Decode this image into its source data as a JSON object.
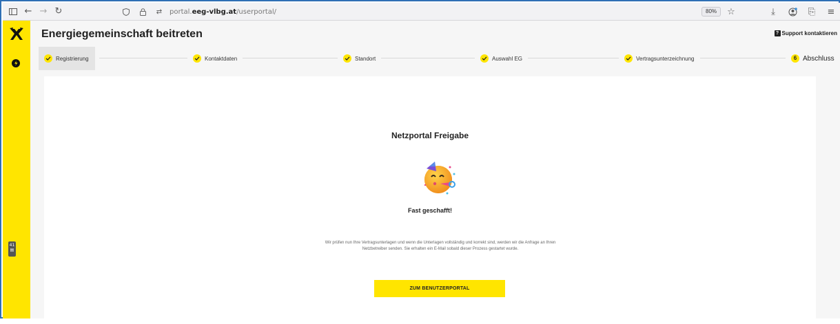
{
  "browser": {
    "url_prefix": "portal.",
    "url_domain": "eeg-vlbg.at",
    "url_path": "/userportal/",
    "zoom": "80%",
    "back_icon": "arrow-left-icon",
    "forward_icon": "arrow-right-icon",
    "reload_icon": "reload-icon"
  },
  "sidebar": {
    "badge": "41"
  },
  "header": {
    "title": "Energiegemeinschaft beitreten",
    "support_label": "Support kontaktieren",
    "support_icon": "?"
  },
  "stepper": {
    "steps": [
      {
        "label": "Registrierung",
        "state": "done"
      },
      {
        "label": "Kontaktdaten",
        "state": "done"
      },
      {
        "label": "Standort",
        "state": "done"
      },
      {
        "label": "Auswahl EG",
        "state": "done"
      },
      {
        "label": "Vertragsunterzeichnung",
        "state": "done"
      },
      {
        "label": "Abschluss",
        "state": "current",
        "number": "6"
      }
    ]
  },
  "card": {
    "title": "Netzportal Freigabe",
    "subtitle": "Fast geschafft!",
    "text_line1": "Wir prüfen nun Ihre Vertragsunterlagen und wenn die Unterlagen vollständig und korrekt sind, werden wir die Anfrage an Ihren",
    "text_line2": "Netzbetreiber senden. Sie erhalten ein E-Mail sobald dieser Prozess gestartet wurde.",
    "button_label": "ZUM BENUTZERPORTAL"
  },
  "colors": {
    "brand_yellow": "#ffe500",
    "background": "#f6f6f6",
    "card": "#ffffff"
  }
}
